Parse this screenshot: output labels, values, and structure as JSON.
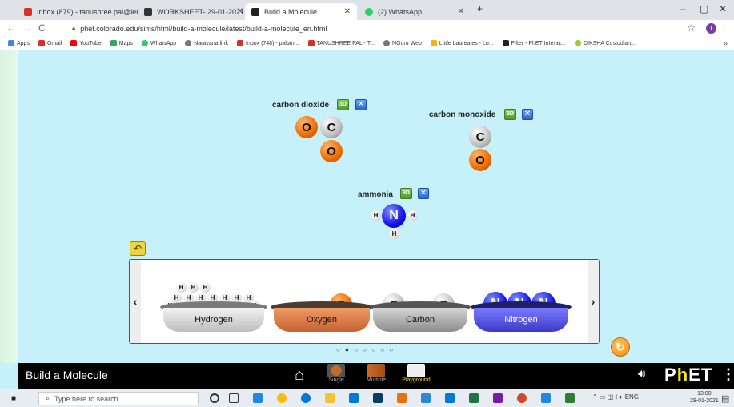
{
  "browser": {
    "tabs": [
      {
        "label": "Inbox (879) - tanushree.pal@lern..."
      },
      {
        "label": "WORKSHEET- 29-01-2021"
      },
      {
        "label": "Build a Molecule"
      },
      {
        "label": "(2) WhatsApp"
      }
    ],
    "url": "phet.colorado.edu/sims/html/build-a-molecule/latest/build-a-molecule_en.html",
    "profile_initial": "T",
    "bookmarks": [
      "Apps",
      "Gmail",
      "YouTube",
      "Maps",
      "WhatsApp",
      "Narayana link",
      "Inbox (748) - paltan...",
      "TANUSHREE PAL - T...",
      "NGuru Web",
      "Little Laureates - Lo...",
      "Filter - PhET Interac...",
      "DIKSHA Custodian..."
    ]
  },
  "sim": {
    "title": "Build a Molecule",
    "molecules": {
      "co2": {
        "name": "carbon dioxide",
        "atoms": [
          "O",
          "C",
          "O"
        ]
      },
      "co": {
        "name": "carbon monoxide",
        "atoms": [
          "C",
          "O"
        ]
      },
      "nh3": {
        "name": "ammonia",
        "atoms": [
          "H",
          "N",
          "H",
          "H"
        ]
      }
    },
    "btn_3d": "3D",
    "kit": {
      "buckets": [
        {
          "label": "Hydrogen",
          "color": "#d9d9d9"
        },
        {
          "label": "Oxygen",
          "color": "#e8874e"
        },
        {
          "label": "Carbon",
          "color": "#b8b8b8"
        },
        {
          "label": "Nitrogen",
          "color": "#4b4bdc"
        }
      ],
      "hydrogen_atom": "H",
      "oxygen_atom": "O",
      "carbon_atom": "C",
      "nitrogen_atom": "N",
      "left_arrow": "‹",
      "right_arrow": "›"
    },
    "page_dots": "○ ● ○ ○ ○ ○ ○"
  },
  "navbar": {
    "screens": [
      {
        "label": "Single"
      },
      {
        "label": "Multiple"
      },
      {
        "label": "Playground"
      }
    ],
    "logo": "PhET"
  },
  "taskbar": {
    "search_placeholder": "Type here to search",
    "tray_lang": "ENG",
    "time": "13:00",
    "date": "29-01-2021"
  }
}
